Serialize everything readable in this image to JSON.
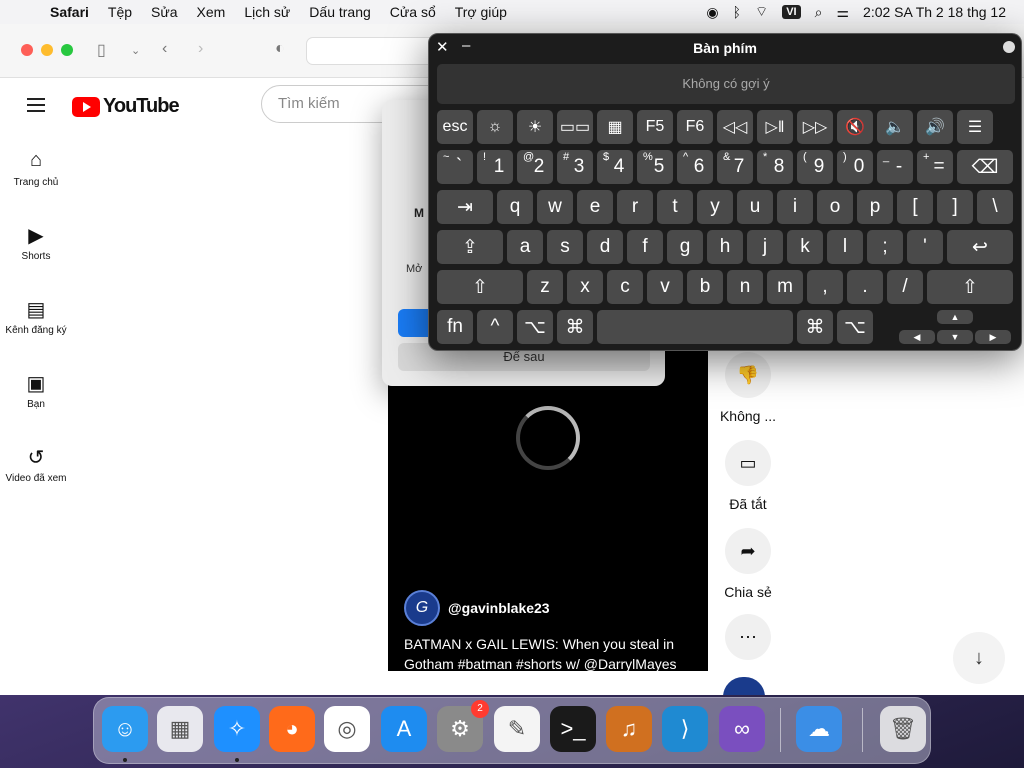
{
  "menubar": {
    "apple_icon": "apple-icon",
    "app_name": "Safari",
    "items": [
      "Tệp",
      "Sửa",
      "Xem",
      "Lịch sử",
      "Dấu trang",
      "Cửa sổ",
      "Trợ giúp"
    ],
    "input_source": "VI",
    "clock": "2:02 SA Th 2 18 thg 12"
  },
  "youtube": {
    "logo_text": "YouTube",
    "search_placeholder": "Tìm kiếm",
    "sidebar": [
      {
        "label": "Trang chủ",
        "icon": "home-icon"
      },
      {
        "label": "Shorts",
        "icon": "shorts-icon"
      },
      {
        "label": "Kênh đăng ký",
        "icon": "subscriptions-icon"
      },
      {
        "label": "Bạn",
        "icon": "library-icon"
      },
      {
        "label": "Video đã xem",
        "icon": "history-icon"
      }
    ],
    "video": {
      "channel": "@gavinblake23",
      "title": "BATMAN x GAIL LEWIS: When you steal in Gotham #batman #shorts w/ @DarrylMayes"
    },
    "actions": [
      {
        "label": "Không ...",
        "icon": "dislike-icon"
      },
      {
        "label": "Đã tắt",
        "icon": "comments-off-icon"
      },
      {
        "label": "Chia sẻ",
        "icon": "share-icon"
      },
      {
        "label": "",
        "icon": "more-icon"
      }
    ]
  },
  "dialog": {
    "line1": "M",
    "line2": "Mở",
    "later_button": "Để sau"
  },
  "keyboard": {
    "title": "Bàn phím",
    "suggestion": "Không có gợi ý",
    "rows": [
      [
        "esc",
        "☼",
        "☀",
        "▭▭",
        "▦",
        "F5",
        "F6",
        "◁◁",
        "▷‖",
        "▷▷",
        "🔇",
        "🔈",
        "🔊",
        "☰"
      ],
      [
        "`",
        "1",
        "2",
        "3",
        "4",
        "5",
        "6",
        "7",
        "8",
        "9",
        "0",
        "-",
        "=",
        "⌫"
      ],
      [
        "⇥",
        "q",
        "w",
        "e",
        "r",
        "t",
        "y",
        "u",
        "i",
        "o",
        "p",
        "[",
        "]",
        "\\"
      ],
      [
        "⇪",
        "a",
        "s",
        "d",
        "f",
        "g",
        "h",
        "j",
        "k",
        "l",
        ";",
        "'",
        "↩"
      ],
      [
        "⇧",
        "z",
        "x",
        "c",
        "v",
        "b",
        "n",
        "m",
        ",",
        ".",
        "/",
        "⇧"
      ],
      [
        "fn",
        "^",
        "⌥",
        "⌘",
        "",
        "⌘",
        "⌥",
        "◀",
        "▲",
        "▼",
        "▶"
      ]
    ],
    "shift_symbols": [
      "~",
      "!",
      "@",
      "#",
      "$",
      "%",
      "^",
      "&",
      "*",
      "(",
      ")",
      "_",
      "+"
    ]
  },
  "dock": {
    "apps": [
      {
        "name": "Finder",
        "icon": "finder-icon",
        "color": "#2c9bf0"
      },
      {
        "name": "Launchpad",
        "icon": "launchpad-icon",
        "color": "#e8e8ee"
      },
      {
        "name": "Safari",
        "icon": "safari-icon",
        "color": "#1e90ff"
      },
      {
        "name": "Firefox",
        "icon": "firefox-icon",
        "color": "#ff6a1a"
      },
      {
        "name": "Chrome",
        "icon": "chrome-icon",
        "color": "#ffffff"
      },
      {
        "name": "App Store",
        "icon": "appstore-icon",
        "color": "#1e8cf0"
      },
      {
        "name": "System Settings",
        "icon": "settings-icon",
        "color": "#8a8a8a",
        "badge": "2"
      },
      {
        "name": "TextEdit",
        "icon": "textedit-icon",
        "color": "#f4f4f4"
      },
      {
        "name": "Terminal",
        "icon": "terminal-icon",
        "color": "#1a1a1a"
      },
      {
        "name": "GarageBand",
        "icon": "garageband-icon",
        "color": "#d07020"
      },
      {
        "name": "VS Code",
        "icon": "vscode-icon",
        "color": "#1f8ad2"
      },
      {
        "name": "Visual Studio",
        "icon": "visualstudio-icon",
        "color": "#7a4fbf"
      },
      {
        "name": "Weather",
        "icon": "weather-icon",
        "color": "#3b8ee6"
      },
      {
        "name": "Trash",
        "icon": "trash-icon",
        "color": "#dcdce0"
      }
    ]
  }
}
